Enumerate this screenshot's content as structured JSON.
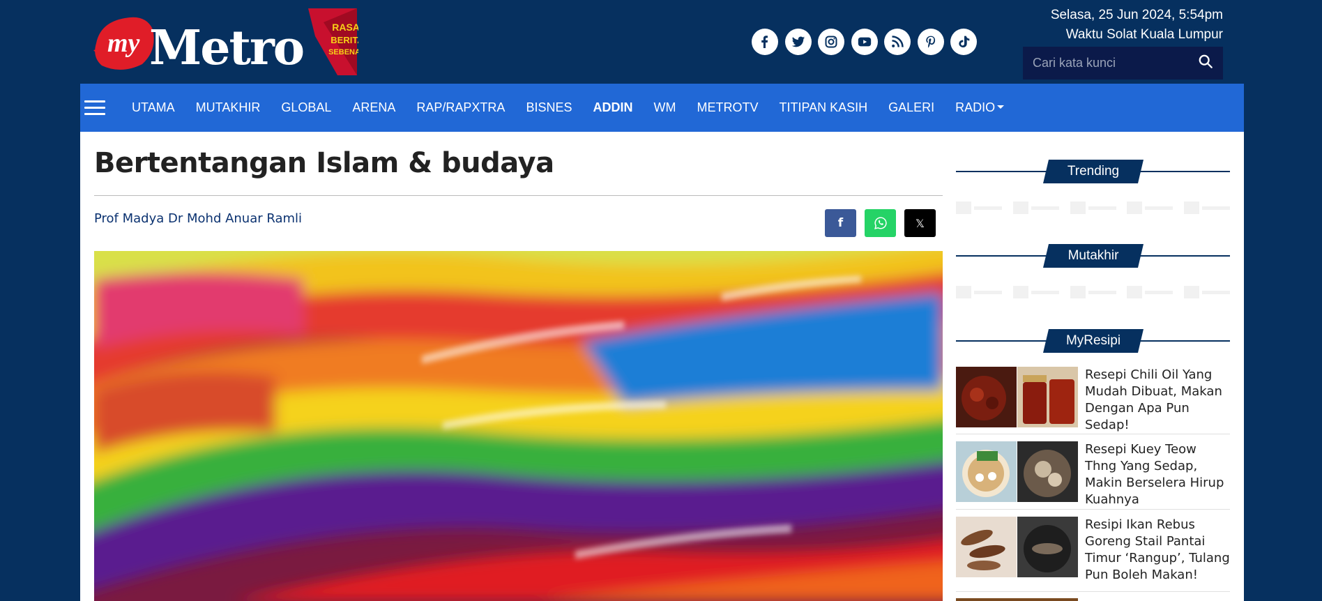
{
  "header": {
    "logo_text": "Metro",
    "logo_prefix": "my",
    "logo_tagline": [
      "RASAI",
      "BERITA",
      "SEBENAR"
    ],
    "date": "Selasa, 25 Jun 2024, 5:54pm",
    "prayer": "Waktu Solat Kuala Lumpur",
    "search_placeholder": "Cari kata kunci",
    "social_icons": [
      "facebook-icon",
      "twitter-icon",
      "instagram-icon",
      "youtube-icon",
      "rss-icon",
      "pinterest-icon",
      "tiktok-icon"
    ]
  },
  "nav": {
    "items": [
      "UTAMA",
      "MUTAKHIR",
      "GLOBAL",
      "ARENA",
      "RAP/RAPXTRA",
      "BISNES",
      "ADDIN",
      "WM",
      "METROTV",
      "TITIPAN KASIH",
      "GALERI",
      "RADIO"
    ],
    "active": "ADDIN"
  },
  "article": {
    "title": "Bertentangan Islam & budaya",
    "author": "Prof Madya Dr Mohd Anuar Ramli"
  },
  "share": {
    "facebook": "f",
    "twitter": "𝕏"
  },
  "sidebar": {
    "trending": "Trending",
    "mutakhir": "Mutakhir",
    "myresipi": "MyResipi",
    "recipes": [
      "Resepi Chili Oil Yang Mudah Dibuat, Makan Dengan Apa Pun Sedap!",
      "Resepi Kuey Teow Thng Yang Sedap, Makin Berselera Hirup Kuahnya",
      "Resipi Ikan Rebus Goreng Stail Pantai Timur ‘Rangup’, Tulang Pun Boleh Makan!"
    ]
  },
  "colors": {
    "page_bg": "#06305f",
    "nav_bg": "#2168d6",
    "search_bg": "#0b1a4a",
    "facebook": "#3b5998",
    "whatsapp": "#25d366",
    "twitter": "#000000"
  }
}
